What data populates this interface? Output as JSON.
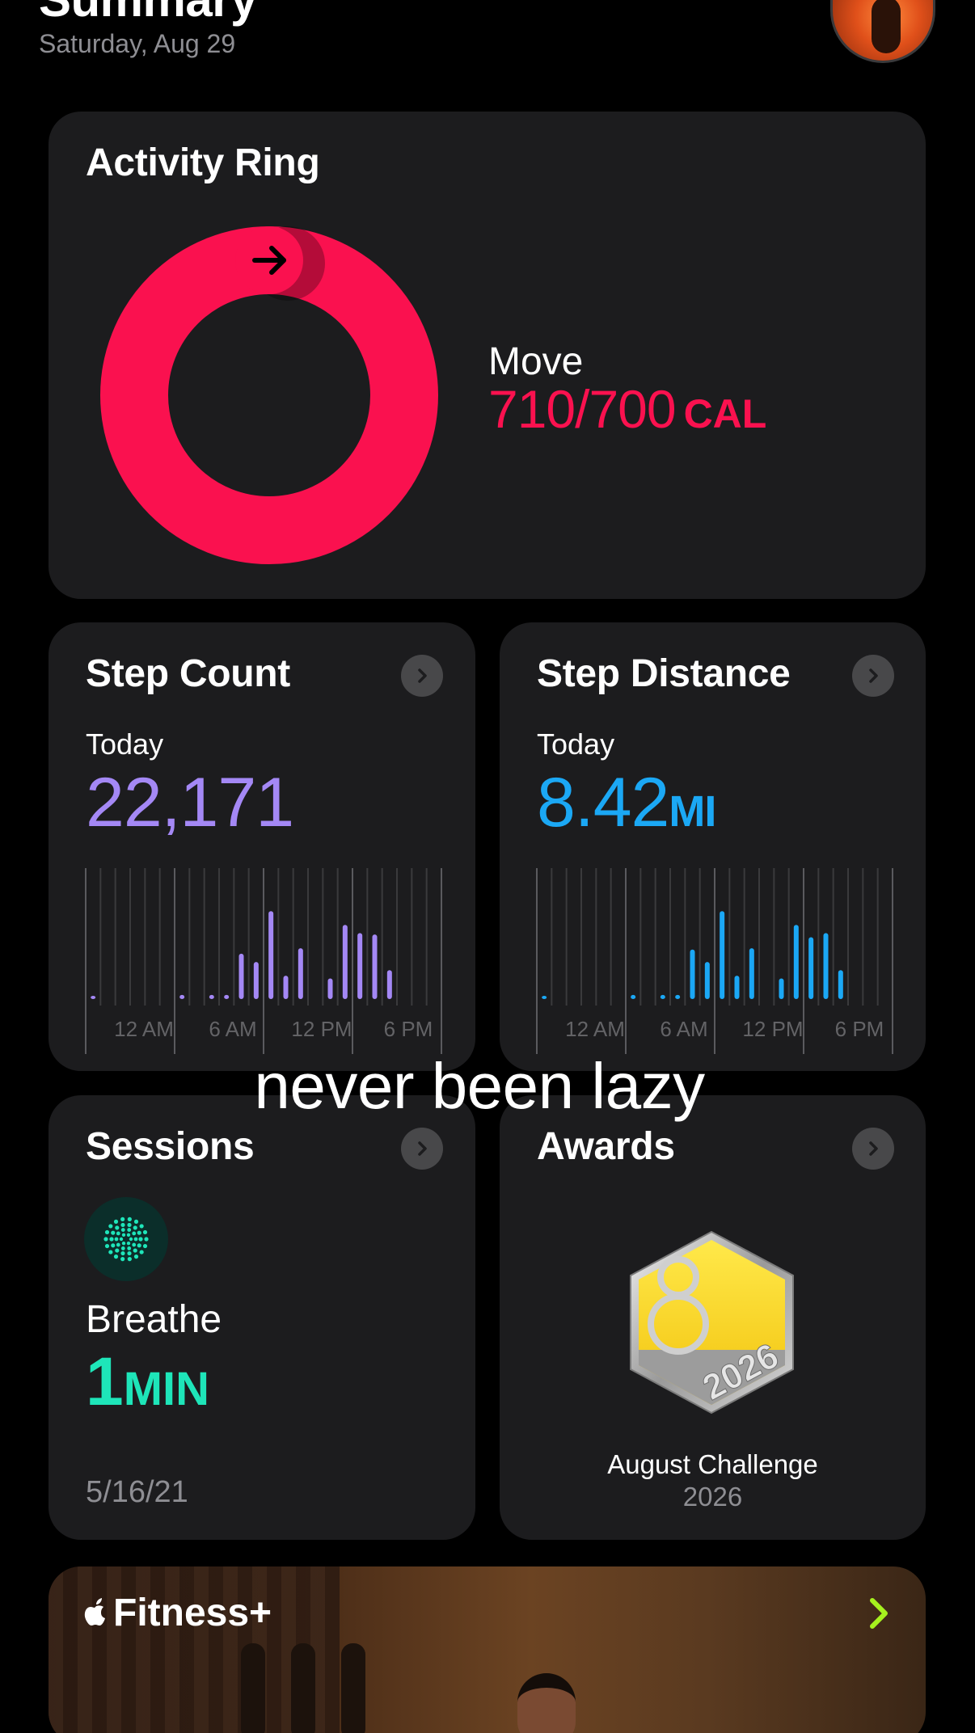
{
  "header": {
    "title": "Summary",
    "date": "Saturday, Aug 29"
  },
  "activity": {
    "title": "Activity Ring",
    "move_label": "Move",
    "move_value": "710/700",
    "move_unit": "CAL",
    "move_progress": 1.014,
    "ring_color": "#fa114f"
  },
  "step_count": {
    "title": "Step Count",
    "period": "Today",
    "value": "22,171",
    "color": "#a488f5",
    "axis_labels": [
      "12 AM",
      "6 AM",
      "12 PM",
      "6 PM"
    ],
    "hourly_relative": [
      0.02,
      0,
      0,
      0,
      0,
      0,
      0.03,
      0,
      0.03,
      0.03,
      0.33,
      0.27,
      0.64,
      0.17,
      0.37,
      0,
      0.15,
      0.54,
      0.48,
      0.47,
      0.21,
      0,
      0,
      0
    ]
  },
  "step_distance": {
    "title": "Step Distance",
    "period": "Today",
    "value": "8.42",
    "unit": "MI",
    "color": "#1ba8f5",
    "axis_labels": [
      "12 AM",
      "6 AM",
      "12 PM",
      "6 PM"
    ],
    "hourly_relative": [
      0.02,
      0,
      0,
      0,
      0,
      0,
      0.03,
      0,
      0.03,
      0.03,
      0.36,
      0.27,
      0.64,
      0.17,
      0.37,
      0,
      0.15,
      0.54,
      0.45,
      0.48,
      0.21,
      0,
      0,
      0
    ]
  },
  "sessions": {
    "title": "Sessions",
    "name": "Breathe",
    "value": "1",
    "unit": "MIN",
    "date": "5/16/21",
    "color": "#1ee5b9"
  },
  "awards": {
    "title": "Awards",
    "award_name": "August Challenge",
    "award_year": "2026",
    "badge_numeral": "8",
    "badge_year": "2026"
  },
  "caption": "never been lazy",
  "fitness": {
    "title": "Fitness+",
    "chevron_color": "#a6f11e"
  }
}
